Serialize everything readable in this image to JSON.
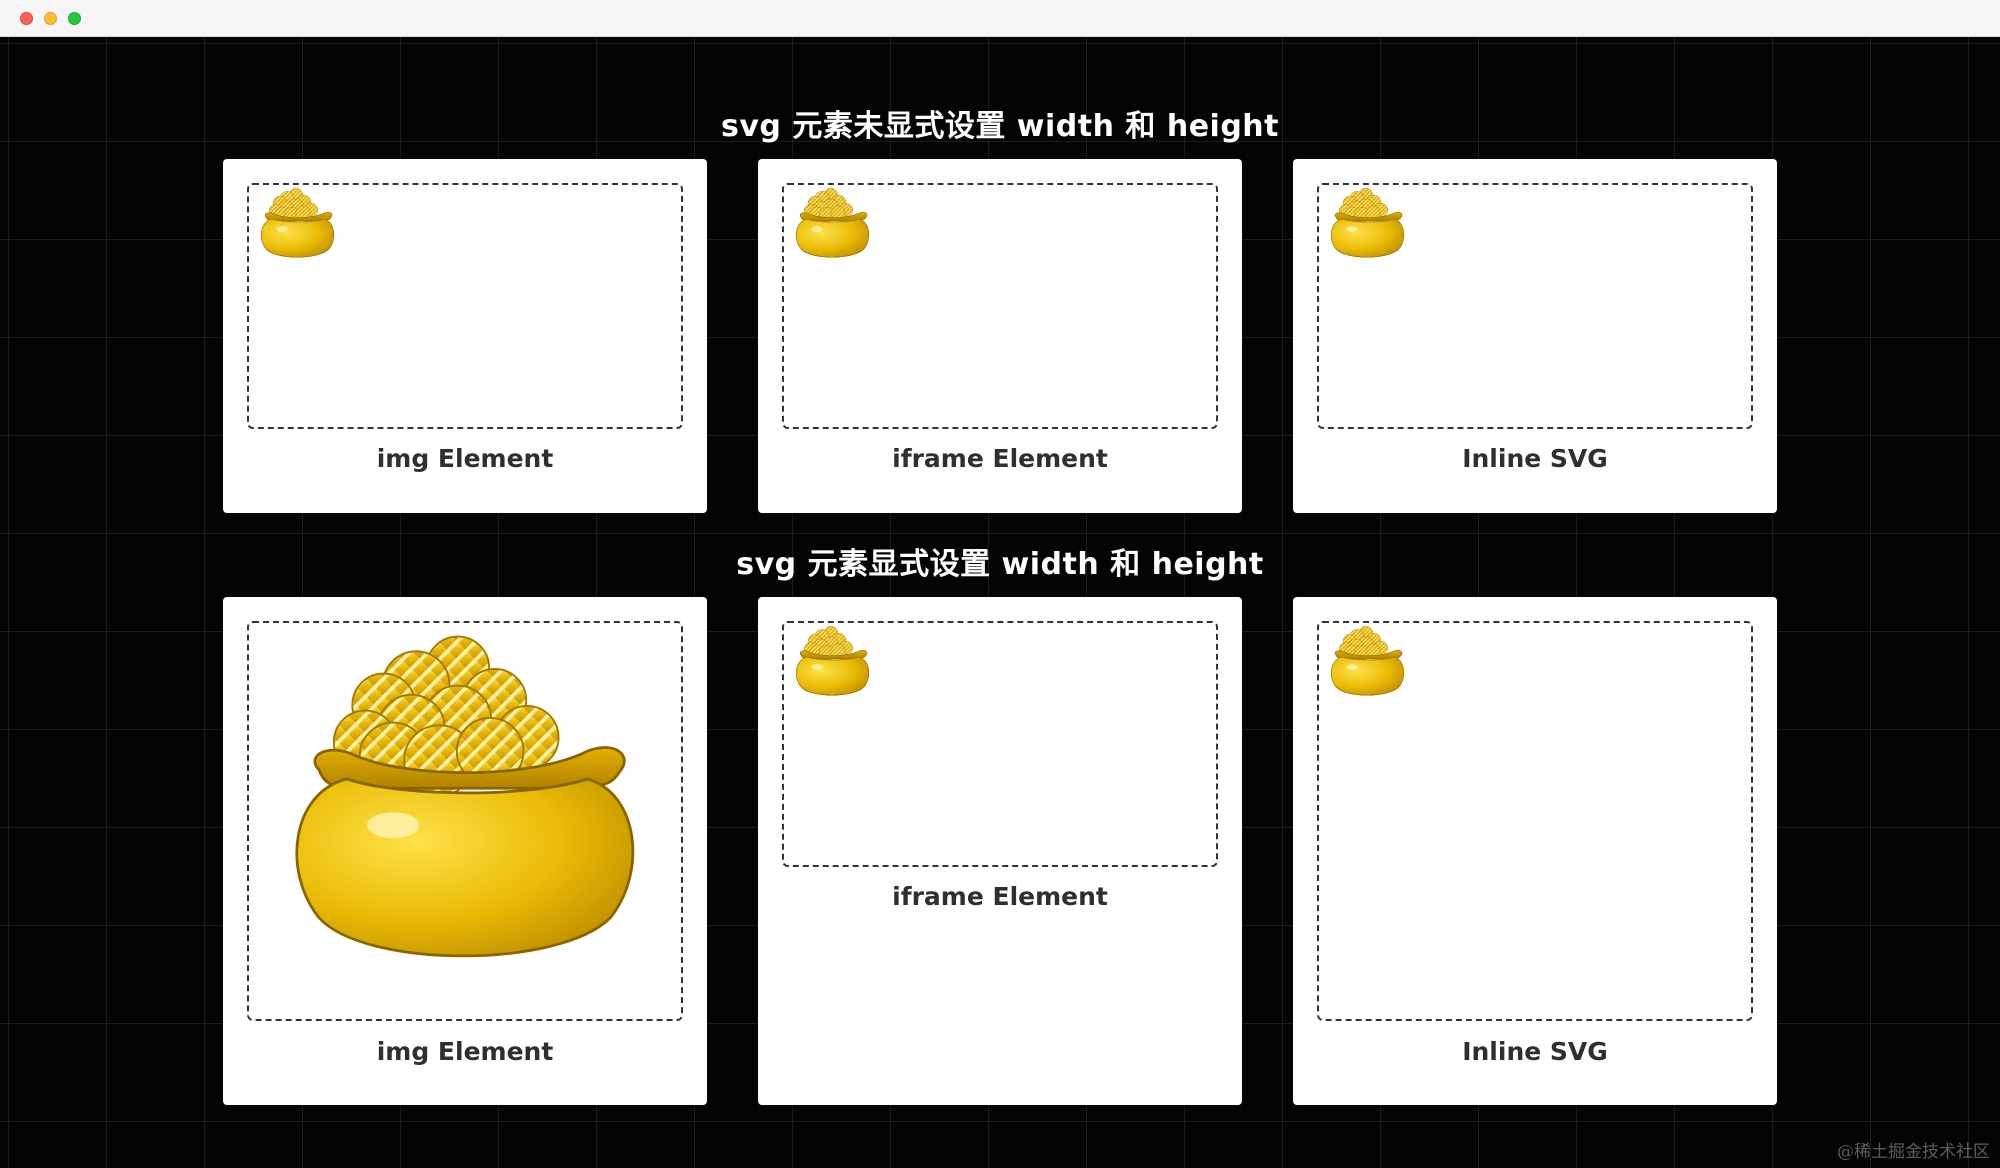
{
  "window": {
    "traffic_lights": [
      "close",
      "minimize",
      "maximize"
    ]
  },
  "sections": [
    {
      "title": "svg 元素未显式设置 width 和 height",
      "cards": [
        {
          "caption": "img Element",
          "image": "gold-pot-icon"
        },
        {
          "caption": "iframe Element",
          "image": "gold-pot-icon"
        },
        {
          "caption": "Inline SVG",
          "image": "gold-pot-icon"
        }
      ]
    },
    {
      "title": "svg 元素显式设置 width 和 height",
      "cards": [
        {
          "caption": "img Element",
          "image": "gold-pot-icon"
        },
        {
          "caption": "iframe Element",
          "image": "gold-pot-icon"
        },
        {
          "caption": "Inline SVG",
          "image": "gold-pot-icon"
        }
      ]
    }
  ],
  "watermark": "@稀土掘金技术社区",
  "colors": {
    "background": "#040404",
    "card": "#ffffff",
    "gold": "#e6b800"
  }
}
